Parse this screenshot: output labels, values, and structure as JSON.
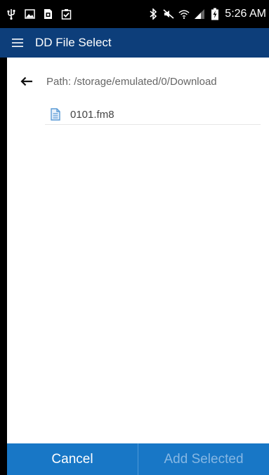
{
  "status_bar": {
    "time": "5:26 AM",
    "left_icons": [
      "usb-icon",
      "image-icon",
      "sim-card-icon",
      "clipboard-check-icon"
    ],
    "right_icons": [
      "bluetooth-icon",
      "mute-icon",
      "wifi-icon",
      "signal-icon",
      "battery-charging-icon"
    ]
  },
  "app_bar": {
    "title": "DD File Select",
    "menu_icon": "hamburger-menu-icon"
  },
  "browser": {
    "path_label": "Path: /storage/emulated/0/Download",
    "back_icon": "arrow-left-icon",
    "files": [
      {
        "name": "0101.fm8",
        "icon": "document-icon"
      }
    ]
  },
  "bottom_bar": {
    "cancel_label": "Cancel",
    "add_selected_label": "Add Selected"
  },
  "colors": {
    "app_bar": "#0d3e7a",
    "bottom_bar": "#1877c6",
    "file_icon": "#5b9bd5"
  }
}
